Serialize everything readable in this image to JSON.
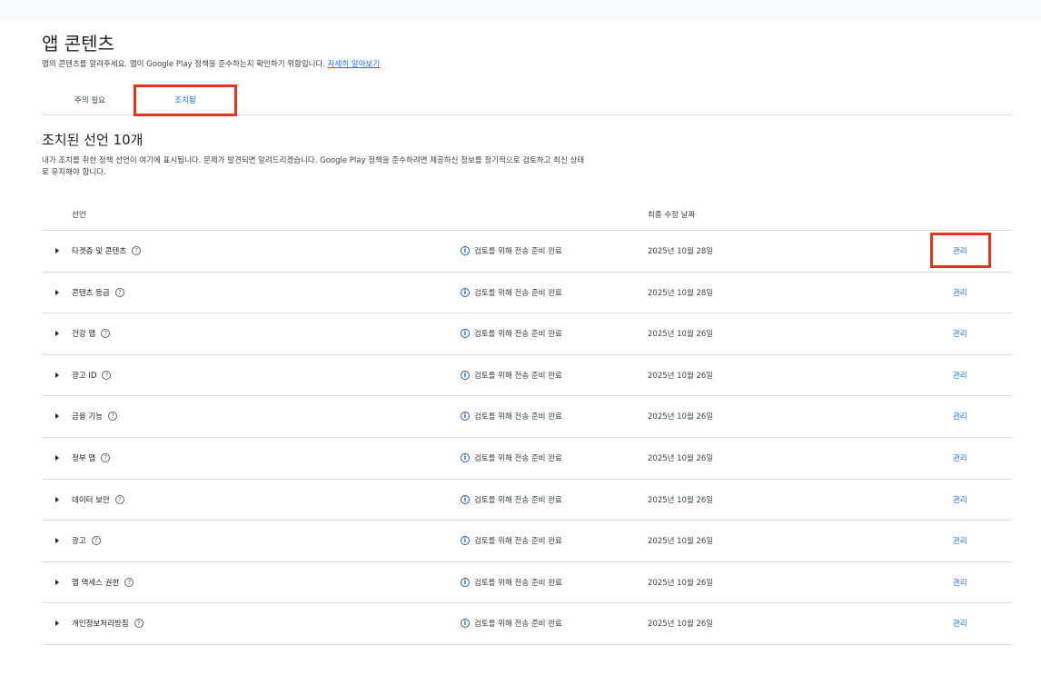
{
  "page": {
    "title": "앱 콘텐츠",
    "subtitle": "앱의 콘텐츠를 알려주세요. 앱이 Google Play 정책을 준수하는지 확인하기 위함입니다.",
    "learn_more": "자세히 알아보기"
  },
  "tabs": [
    {
      "label": "주의 필요",
      "active": false
    },
    {
      "label": "조치됨",
      "active": true
    }
  ],
  "section": {
    "title": "조치된 선언 10개",
    "description": "내가 조치를 취한 정책 선언이 여기에 표시됩니다. 문제가 발견되면 알려드리겠습니다. Google Play 정책을 준수하려면 제공하신 정보를 정기적으로 검토하고 최신 상태로 유지해야 합니다."
  },
  "table": {
    "headers": {
      "declaration": "선언",
      "last_modified": "최종 수정 날짜"
    },
    "rows": [
      {
        "name": "타겟층 및 콘텐츠",
        "status": "검토를 위해 전송 준비 완료",
        "date": "2025년 10월 28일",
        "action": "관리"
      },
      {
        "name": "콘텐츠 등급",
        "status": "검토를 위해 전송 준비 완료",
        "date": "2025년 10월 28일",
        "action": "관리"
      },
      {
        "name": "건강 앱",
        "status": "검토를 위해 전송 준비 완료",
        "date": "2025년 10월 26일",
        "action": "관리"
      },
      {
        "name": "광고 ID",
        "status": "검토를 위해 전송 준비 완료",
        "date": "2025년 10월 26일",
        "action": "관리"
      },
      {
        "name": "금융 기능",
        "status": "검토를 위해 전송 준비 완료",
        "date": "2025년 10월 26일",
        "action": "관리"
      },
      {
        "name": "정부 앱",
        "status": "검토를 위해 전송 준비 완료",
        "date": "2025년 10월 26일",
        "action": "관리"
      },
      {
        "name": "데이터 보안",
        "status": "검토를 위해 전송 준비 완료",
        "date": "2025년 10월 26일",
        "action": "관리"
      },
      {
        "name": "광고",
        "status": "검토를 위해 전송 준비 완료",
        "date": "2025년 10월 26일",
        "action": "관리"
      },
      {
        "name": "앱 액세스 권한",
        "status": "검토를 위해 전송 준비 완료",
        "date": "2025년 10월 26일",
        "action": "관리"
      },
      {
        "name": "개인정보처리방침",
        "status": "검토를 위해 전송 준비 완료",
        "date": "2025년 10월 26일",
        "action": "관리"
      }
    ]
  },
  "icons": {
    "help": "?",
    "info": "i"
  },
  "colors": {
    "accent": "#1a73e8",
    "highlight": "#e8321c",
    "divider": "#dadce0"
  }
}
